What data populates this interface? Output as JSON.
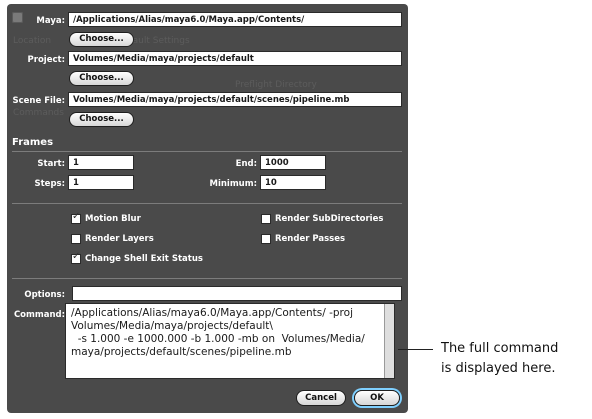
{
  "paths": {
    "maya_label": "Maya:",
    "maya_value": "/Applications/Alias/maya6.0/Maya.app/Contents/",
    "project_label": "Project:",
    "project_value": "Volumes/Media/maya/projects/default",
    "scene_label": "Scene File:",
    "scene_value": "Volumes/Media/maya/projects/default/scenes/pipeline.mb",
    "choose_label": "Choose..."
  },
  "frames": {
    "title": "Frames",
    "start_label": "Start:",
    "start_value": "1",
    "end_label": "End:",
    "end_value": "1000",
    "steps_label": "Steps:",
    "steps_value": "1",
    "minimum_label": "Minimum:",
    "minimum_value": "10"
  },
  "options": {
    "motion_blur": {
      "label": "Motion Blur",
      "checked": true
    },
    "render_subdirectories": {
      "label": "Render SubDirectories",
      "checked": false
    },
    "render_layers": {
      "label": "Render Layers",
      "checked": false
    },
    "render_passes": {
      "label": "Render Passes",
      "checked": false
    },
    "change_shell_exit_status": {
      "label": "Change Shell Exit Status",
      "checked": true
    },
    "options_label": "Options:",
    "options_value": ""
  },
  "command": {
    "label": "Command:",
    "value": "/Applications/Alias/maya6.0/Maya.app/Contents/ -proj\nVolumes/Media/maya/projects/default\\\n  -s 1.000 -e 1000.000 -b 1.000 -mb on  Volumes/Media/\nmaya/projects/default/scenes/pipeline.mb"
  },
  "buttons": {
    "cancel": "Cancel",
    "ok": "OK"
  },
  "callout": {
    "line1": "The full command",
    "line2": "is displayed here."
  },
  "colors": {
    "dialog_bg": "#4a4a4a",
    "ok_glow": "#7fd0ff"
  }
}
